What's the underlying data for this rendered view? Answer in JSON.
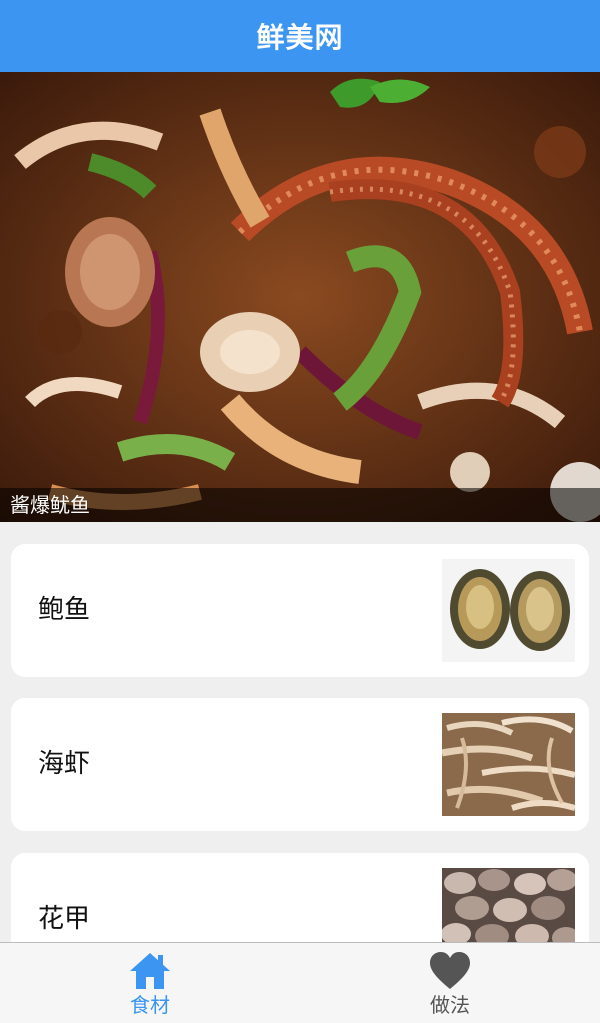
{
  "app": {
    "title": "鲜美网"
  },
  "hero": {
    "caption": "酱爆鱿鱼"
  },
  "items": [
    {
      "label": "鲍鱼",
      "thumb": "abalone"
    },
    {
      "label": "海虾",
      "thumb": "shrimp"
    },
    {
      "label": "花甲",
      "thumb": "clams"
    }
  ],
  "nav": {
    "ingredients_label": "食材",
    "methods_label": "做法",
    "active_color": "#3b95f1",
    "inactive_color": "#555555",
    "ingredients_icon": "home-icon",
    "methods_icon": "heart-icon"
  }
}
